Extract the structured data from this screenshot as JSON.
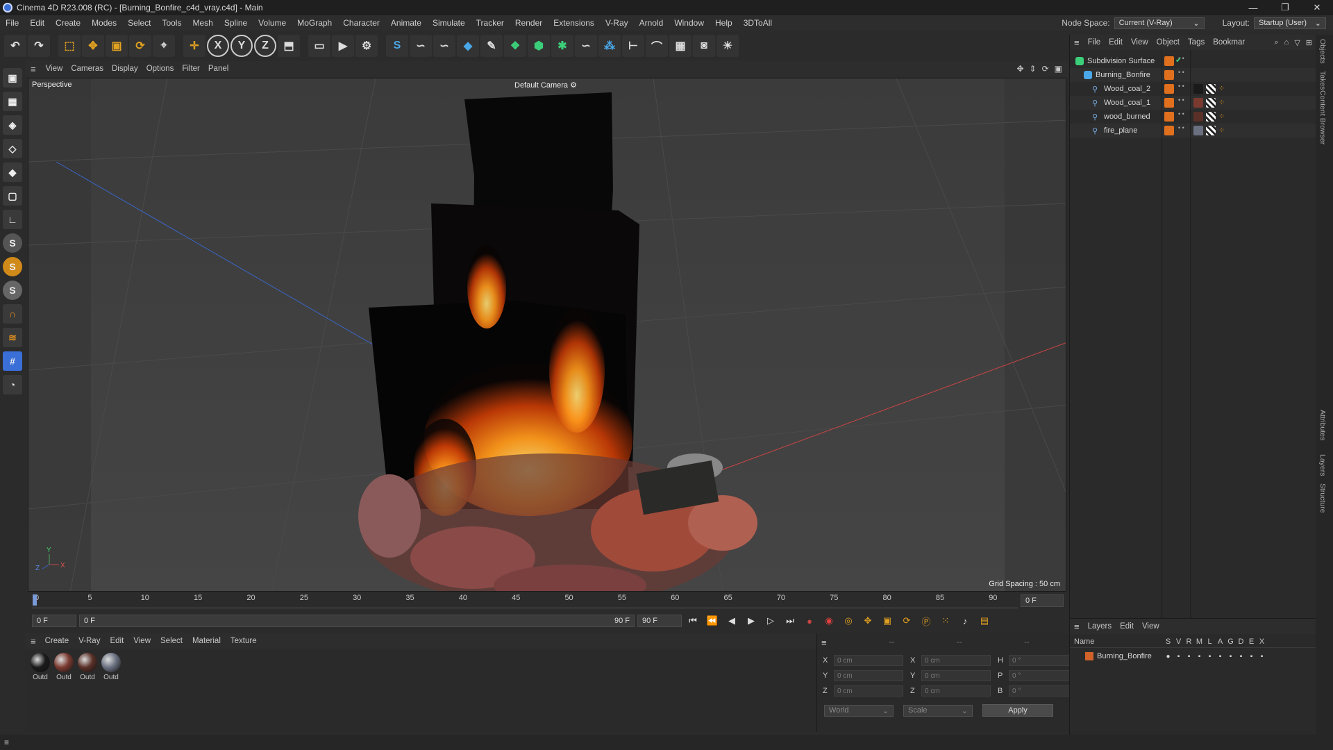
{
  "window": {
    "title": "Cinema 4D R23.008 (RC) - [Burning_Bonfire_c4d_vray.c4d] - Main",
    "min": "—",
    "max": "❐",
    "close": "✕"
  },
  "menu": [
    "File",
    "Edit",
    "Create",
    "Modes",
    "Select",
    "Tools",
    "Mesh",
    "Spline",
    "Volume",
    "MoGraph",
    "Character",
    "Animate",
    "Simulate",
    "Tracker",
    "Render",
    "Extensions",
    "V-Ray",
    "Arnold",
    "Window",
    "Help",
    "3DToAll"
  ],
  "node_space": {
    "label": "Node Space:",
    "value": "Current (V-Ray)"
  },
  "layout": {
    "label": "Layout:",
    "value": "Startup (User)"
  },
  "toolbar_icons": [
    "undo-icon",
    "redo-icon",
    "live-select-icon",
    "move-icon",
    "scale-icon",
    "rotate-icon",
    "recent-tool-icon",
    "coordinate-icon",
    "x-axis-icon",
    "y-axis-icon",
    "z-axis-icon",
    "object-coord-icon",
    "render-region-icon",
    "render-view-icon",
    "render-settings-icon",
    "vray-icon",
    "python-icon",
    "python2-icon",
    "cube-icon",
    "pen-icon",
    "cloner-icon",
    "extrude-icon",
    "subdivision-icon",
    "python3-icon",
    "array-icon",
    "measure-icon",
    "deformer-icon",
    "floor-icon",
    "camera-icon",
    "light-icon"
  ],
  "toolbar_glyphs": {
    "x": "X",
    "y": "Y",
    "z": "Z"
  },
  "viewport_menu": [
    "View",
    "Cameras",
    "Display",
    "Options",
    "Filter",
    "Panel"
  ],
  "viewport": {
    "label": "Perspective",
    "camera": "Default Camera",
    "camera_icon": "camera-icon",
    "grid": "Grid Spacing : 50 cm"
  },
  "timeline": {
    "ticks": [
      "0",
      "5",
      "10",
      "15",
      "20",
      "25",
      "30",
      "35",
      "40",
      "45",
      "50",
      "55",
      "60",
      "65",
      "70",
      "75",
      "80",
      "85",
      "90"
    ],
    "frame_field": "0 F"
  },
  "transport": {
    "start": "0 F",
    "range_start": "0 F",
    "range_end": "90 F",
    "end": "90 F"
  },
  "material_menu": [
    "Create",
    "V-Ray",
    "Edit",
    "View",
    "Select",
    "Material",
    "Texture"
  ],
  "materials": [
    {
      "label": "Outd",
      "color": "#1a1a1a"
    },
    {
      "label": "Outd",
      "color": "#7a3a30"
    },
    {
      "label": "Outd",
      "color": "#5a3028"
    },
    {
      "label": "Outd",
      "color": "#6a7080"
    }
  ],
  "coords": {
    "header": [
      "--",
      "--",
      "--"
    ],
    "rows": [
      {
        "a": "X",
        "av": "0 cm",
        "b": "X",
        "bv": "0 cm",
        "c": "H",
        "cv": "0 °"
      },
      {
        "a": "Y",
        "av": "0 cm",
        "b": "Y",
        "bv": "0 cm",
        "c": "P",
        "cv": "0 °"
      },
      {
        "a": "Z",
        "av": "0 cm",
        "b": "Z",
        "bv": "0 cm",
        "c": "B",
        "cv": "0 °"
      }
    ],
    "space": "World",
    "mode": "Scale",
    "apply": "Apply"
  },
  "object_menu": [
    "File",
    "Edit",
    "View",
    "Object",
    "Tags",
    "Bookmar"
  ],
  "objects": [
    {
      "name": "Subdivision Surface",
      "indent": 0
    },
    {
      "name": "Burning_Bonfire",
      "indent": 1
    },
    {
      "name": "Wood_coal_2",
      "indent": 2
    },
    {
      "name": "Wood_coal_1",
      "indent": 2
    },
    {
      "name": "wood_burned",
      "indent": 2
    },
    {
      "name": "fire_plane",
      "indent": 2
    }
  ],
  "layer_menu": [
    "Layers",
    "Edit",
    "View"
  ],
  "layer_cols": {
    "name": "Name",
    "flags": [
      "S",
      "V",
      "R",
      "M",
      "L",
      "A",
      "G",
      "D",
      "E",
      "X"
    ]
  },
  "layers": [
    {
      "name": "Burning_Bonfire",
      "color": "#d0622a"
    }
  ],
  "side_tabs": [
    "Objects",
    "Takes",
    "Content Browser",
    "Attributes",
    "Layers",
    "Structure"
  ],
  "colors": {
    "accent": "#e0701d",
    "axis_x": "#c84444",
    "axis_y": "#44aa55",
    "axis_z": "#3a66c8"
  }
}
